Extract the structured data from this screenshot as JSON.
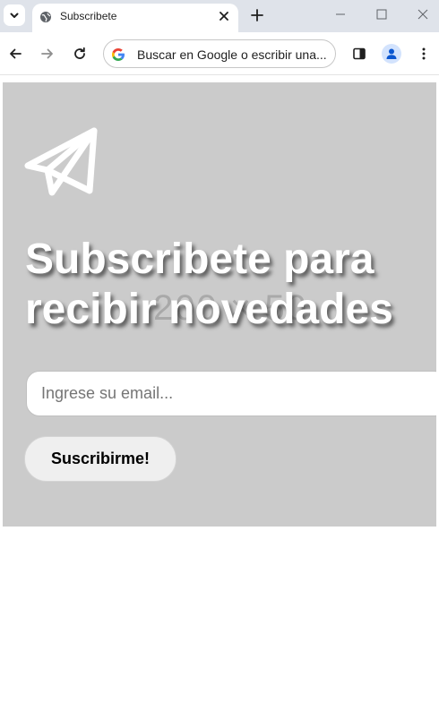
{
  "browser": {
    "tab_title": "Subscribete",
    "address_bar_text": "Buscar en Google o escribir una..."
  },
  "icons": {
    "tab_search": "chevron-down-icon",
    "favicon": "globe-icon",
    "tab_close": "close-icon",
    "new_tab": "plus-icon",
    "back": "arrow-left-icon",
    "forward": "arrow-right-icon",
    "reload": "reload-icon",
    "search_engine": "google-icon",
    "side_panel": "side-panel-icon",
    "profile": "profile-icon",
    "menu": "more-vert-icon",
    "hero": "paper-plane-icon"
  },
  "page": {
    "heading": "Subscribete para recibir novedades",
    "watermark": "200 × 50",
    "email_placeholder": "Ingrese su email...",
    "email_value": "",
    "submit_label": "Suscribirme!"
  },
  "colors": {
    "hero_background": "#cbcbcb",
    "heading_text": "#ffffff",
    "button_background": "#efefef",
    "tabbar_background": "#dfe3ea"
  }
}
